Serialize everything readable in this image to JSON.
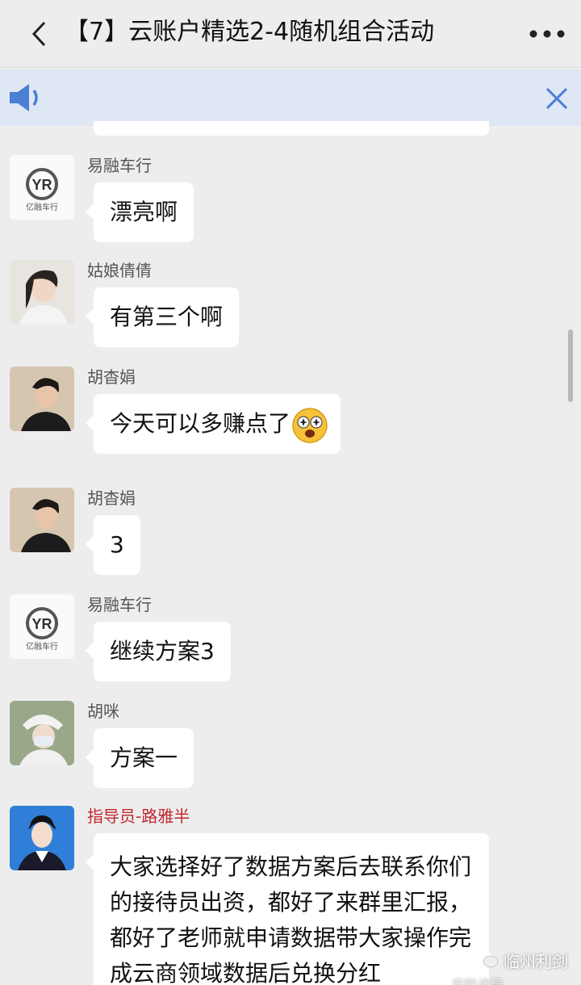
{
  "titlebar": {
    "title": "【7】云账户精选2-4随机组合活动",
    "back_icon": "chevron-left-icon",
    "more_icon": "more-dots-icon"
  },
  "notice": {
    "speaker_icon": "speaker-icon",
    "close_icon": "close-icon",
    "accent": "#4a7fd4"
  },
  "messages": [
    {
      "sender": "易融车行",
      "text": "漂亮啊",
      "avatar": "logo",
      "logo_text": "亿融车行"
    },
    {
      "sender": "姑娘倩倩",
      "text": "有第三个啊",
      "avatar": "photo"
    },
    {
      "sender": "胡杳娟",
      "text": "今天可以多赚点了",
      "avatar": "photo",
      "emoji": "star-eyes-emoji"
    },
    {
      "sender": "胡杳娟",
      "text": "3",
      "avatar": "photo"
    },
    {
      "sender": "易融车行",
      "text": "继续方案3",
      "avatar": "logo",
      "logo_text": "亿融车行"
    },
    {
      "sender": "胡咪",
      "text": "方案一",
      "avatar": "photo"
    },
    {
      "sender": "指导员-路雅半",
      "text": "大家选择好了数据方案后去联系你们的接待员出资，都好了来群里汇报，都好了老师就申请数据带大家操作完成云商领域数据后兑换分红",
      "avatar": "photo",
      "sender_color": "#c0262e"
    }
  ],
  "watermark": {
    "name": "临州利剑",
    "sub": "安防咨导"
  }
}
